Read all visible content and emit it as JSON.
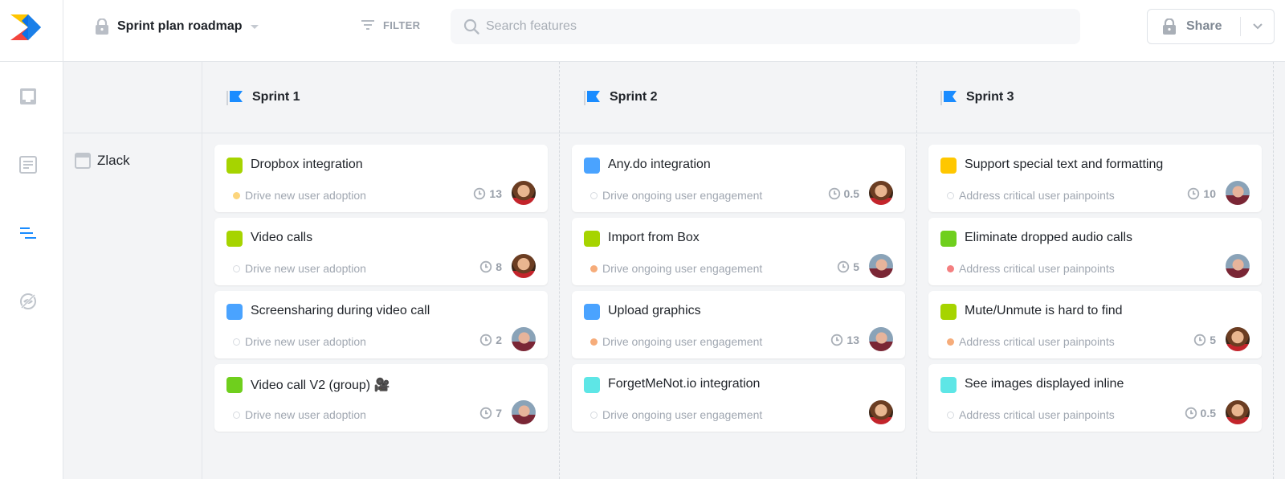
{
  "header": {
    "title": "Sprint plan roadmap",
    "filter_label": "FILTER",
    "search_placeholder": "Search features",
    "search_value": "",
    "share_label": "Share"
  },
  "sidebar": {
    "items": [
      {
        "name": "inbox-icon",
        "active": false
      },
      {
        "name": "document-icon",
        "active": false
      },
      {
        "name": "roadmap-icon",
        "active": true
      },
      {
        "name": "hidden-view-icon",
        "active": false
      }
    ],
    "accent": "#1a8cff"
  },
  "row": {
    "product": "Zlack"
  },
  "columns": [
    {
      "label": "Sprint 1",
      "cards": [
        {
          "title": "Dropbox integration",
          "color": "#a6d400",
          "goal": "Drive new user adoption",
          "goal_dot": "#fcd57c",
          "estimate": "13",
          "assignee": "woman"
        },
        {
          "title": "Video calls",
          "color": "#a6d400",
          "goal": "Drive new user adoption",
          "goal_dot": "",
          "estimate": "8",
          "assignee": "woman"
        },
        {
          "title": "Screensharing during video call",
          "color": "#4aa3ff",
          "goal": "Drive new user adoption",
          "goal_dot": "",
          "estimate": "2",
          "assignee": "man"
        },
        {
          "title": "Video call V2 (group) 🎥",
          "color": "#6fcf1d",
          "goal": "Drive new user adoption",
          "goal_dot": "",
          "estimate": "7",
          "assignee": "man"
        }
      ]
    },
    {
      "label": "Sprint 2",
      "cards": [
        {
          "title": "Any.do integration",
          "color": "#4aa3ff",
          "goal": "Drive ongoing user engagement",
          "goal_dot": "",
          "estimate": "0.5",
          "assignee": "woman"
        },
        {
          "title": "Import from Box",
          "color": "#a6d400",
          "goal": "Drive ongoing user engagement",
          "goal_dot": "#f6ac7a",
          "estimate": "5",
          "assignee": "man"
        },
        {
          "title": "Upload graphics",
          "color": "#4aa3ff",
          "goal": "Drive ongoing user engagement",
          "goal_dot": "#f6ac7a",
          "estimate": "13",
          "assignee": "man"
        },
        {
          "title": "ForgetMeNot.io integration",
          "color": "#5ee6e6",
          "goal": "Drive ongoing user engagement",
          "goal_dot": "",
          "estimate": "",
          "assignee": "woman"
        }
      ]
    },
    {
      "label": "Sprint 3",
      "cards": [
        {
          "title": "Support special text and formatting",
          "color": "#ffc700",
          "goal": "Address critical user painpoints",
          "goal_dot": "",
          "estimate": "10",
          "assignee": "man"
        },
        {
          "title": "Eliminate dropped audio calls",
          "color": "#6fcf1d",
          "goal": "Address critical user painpoints",
          "goal_dot": "#f47f80",
          "estimate": "",
          "assignee": "man"
        },
        {
          "title": "Mute/Unmute is hard to find",
          "color": "#a6d400",
          "goal": "Address critical user painpoints",
          "goal_dot": "#f6ac7a",
          "estimate": "5",
          "assignee": "woman"
        },
        {
          "title": "See images displayed inline",
          "color": "#5ee6e6",
          "goal": "Address critical user painpoints",
          "goal_dot": "",
          "estimate": "0.5",
          "assignee": "woman"
        }
      ]
    }
  ]
}
